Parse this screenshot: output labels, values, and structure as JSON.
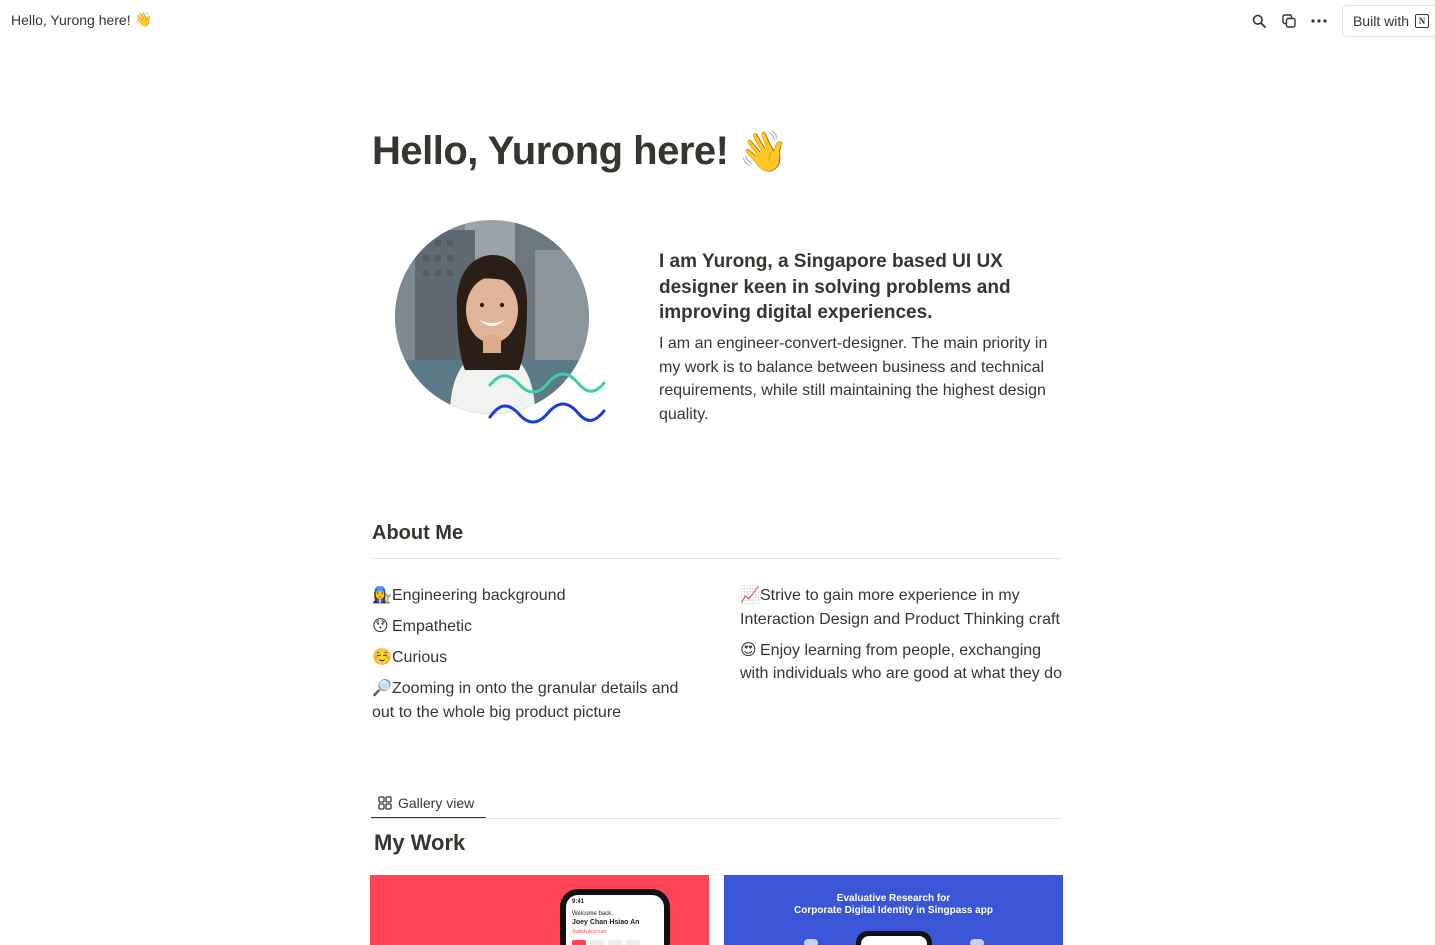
{
  "topbar": {
    "breadcrumb": "Hello, Yurong here!",
    "breadcrumb_emoji": "👋",
    "icons": [
      "search-icon",
      "duplicate-icon",
      "more-icon"
    ],
    "built_with_label": "Built with"
  },
  "page": {
    "title": "Hello, Yurong here!",
    "title_emoji": "👋"
  },
  "hero": {
    "headline": "I am Yurong, a Singapore based UI UX designer keen in solving problems and improving digital experiences.",
    "body": "I am an engineer-convert-designer. The main priority in my work is to balance between business and technical requirements, while still maintaining the highest design quality.",
    "wave_colors": [
      "#3ccfa8",
      "#1a3fd4"
    ]
  },
  "about": {
    "heading": "About Me",
    "left": [
      {
        "emoji": "👩‍🔧",
        "text": "Engineering background"
      },
      {
        "emoji": "😯",
        "text": "Empathetic"
      },
      {
        "emoji": "☺️",
        "text": "Curious"
      },
      {
        "emoji": "🔎",
        "text": "Zooming in onto the granular details and out to the whole big product picture"
      }
    ],
    "right": [
      {
        "emoji": "📈",
        "text": "Strive to gain more experience in my Interaction Design and Product Thinking craft"
      },
      {
        "emoji": "😍",
        "text": "Enjoy learning from people, exchanging with individuals who are good at what they do"
      }
    ]
  },
  "gallery": {
    "tab_label": "Gallery view",
    "title": "My Work",
    "cards": [
      {
        "color": "#ff4455",
        "phone_greeting": "Welcome back,",
        "phone_name": "Joey Chan Hsiao An",
        "phone_action": "Switch Account",
        "phone_time": "9:41"
      },
      {
        "color": "#3a55d6",
        "caption_line1": "Evaluative Research for",
        "caption_line2": "Corporate Digital Identity in Singpass app"
      }
    ]
  }
}
